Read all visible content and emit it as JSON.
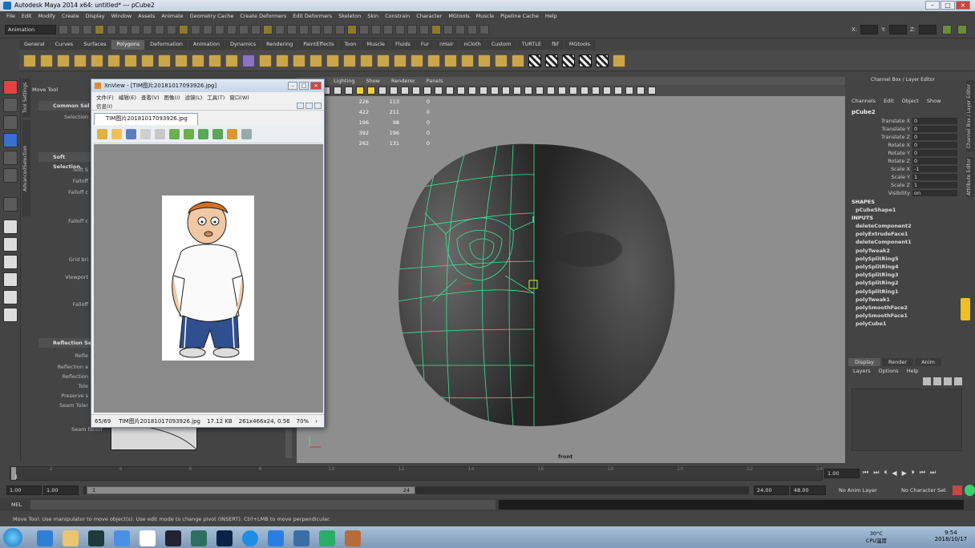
{
  "window": {
    "title": "Autodesk Maya 2014 x64: untitled*   ---   pCube2"
  },
  "menubar": [
    "File",
    "Edit",
    "Modify",
    "Create",
    "Display",
    "Window",
    "Assets",
    "Animate",
    "Geometry Cache",
    "Create Deformers",
    "Edit Deformers",
    "Skeleton",
    "Skin",
    "Constrain",
    "Character",
    "MGtools",
    "Muscle",
    "Pipeline Cache",
    "Help"
  ],
  "statusline": {
    "mode": "Animation",
    "fields": [
      "X:",
      "Y:",
      "Z:"
    ]
  },
  "shelf_tabs": [
    "General",
    "Curves",
    "Surfaces",
    "Polygons",
    "Deformation",
    "Animation",
    "Dynamics",
    "Rendering",
    "PaintEffects",
    "Toon",
    "Muscle",
    "Fluids",
    "Fur",
    "nHair",
    "nCloth",
    "Custom",
    "TURTLE",
    "fbf",
    "MGtools"
  ],
  "shelf_active": "Polygons",
  "tool_settings": {
    "vtabs": [
      "Tool Settings",
      "AdvancedSelection"
    ],
    "header": "Move Tool",
    "sections": [
      {
        "title": "Common Sel",
        "rows": [
          "Selection"
        ]
      },
      {
        "title": "Soft Selection",
        "rows": [
          "Soft S",
          "Falloff",
          "Falloff c",
          "Falloff c",
          "Grid bri",
          "Viewport",
          "Falloff"
        ]
      },
      {
        "title": "Reflection Se",
        "rows": [
          "Refle",
          "Reflection a",
          "Reflection",
          "Tole",
          "Preserve s",
          "Seam Toler",
          "Seam falloff"
        ]
      }
    ]
  },
  "viewport": {
    "menu": [
      "ading",
      "Lighting",
      "Show",
      "Renderer",
      "Panels"
    ],
    "stats": [
      [
        "226",
        "113",
        "0"
      ],
      [
        "422",
        "211",
        "0"
      ],
      [
        "196",
        "98",
        "0"
      ],
      [
        "392",
        "196",
        "0"
      ],
      [
        "262",
        "131",
        "0"
      ]
    ],
    "camera": "front"
  },
  "xnview": {
    "title": "XnView - [TIM图片20181017093926.jpg]",
    "menu": [
      "文件(F)",
      "编辑(E)",
      "查看(V)",
      "图像(I)",
      "滤镜(L)",
      "工具(T)",
      "窗口(W)"
    ],
    "submenu": "信息(I)",
    "tab": "TIM图片20181017093926.jpg",
    "status": {
      "index": "65/69",
      "filename": "TIM图片20181017093926.jpg",
      "size": "17.12 KB",
      "dims": "261x466x24, 0.56",
      "zoom": "70%"
    }
  },
  "channel_box": {
    "tabs_vert": [
      "Channel Box / Layer Editor",
      "Attribute Editor"
    ],
    "title": "Channel Box / Layer Editor",
    "menu": [
      "Channels",
      "Edit",
      "Object",
      "Show"
    ],
    "object": "pCube2",
    "attrs": [
      {
        "k": "Translate X",
        "v": "0"
      },
      {
        "k": "Translate Y",
        "v": "0"
      },
      {
        "k": "Translate Z",
        "v": "0"
      },
      {
        "k": "Rotate X",
        "v": "0"
      },
      {
        "k": "Rotate Y",
        "v": "0"
      },
      {
        "k": "Rotate Z",
        "v": "0"
      },
      {
        "k": "Scale X",
        "v": "-1"
      },
      {
        "k": "Scale Y",
        "v": "1"
      },
      {
        "k": "Scale Z",
        "v": "1"
      },
      {
        "k": "Visibility",
        "v": "on"
      }
    ],
    "shapes_label": "SHAPES",
    "shapes": [
      "pCubeShape1"
    ],
    "inputs_label": "INPUTS",
    "inputs": [
      "deleteComponent2",
      "polyExtrudeFace1",
      "deleteComponent1",
      "polyTweak2",
      "polySplitRing5",
      "polySplitRing4",
      "polySplitRing3",
      "polySplitRing2",
      "polySplitRing1",
      "polyTweak1",
      "polySmoothFace2",
      "polySmoothFace1",
      "polyCube1"
    ]
  },
  "layer_editor": {
    "tabs": [
      "Display",
      "Render",
      "Anim"
    ],
    "menu": [
      "Layers",
      "Options",
      "Help"
    ]
  },
  "timeline": {
    "ticks": [
      "1",
      "2",
      "4",
      "6",
      "8",
      "10",
      "12",
      "14",
      "16",
      "18",
      "20",
      "22",
      "24"
    ],
    "current": "1.00"
  },
  "range": {
    "start": "1.00",
    "inner_start": "1.00",
    "slider_start": "1",
    "slider_end": "24",
    "end": "24.00",
    "outer_end": "48.00",
    "anim_layer": "No Anim Layer",
    "character": "No Character Set"
  },
  "mel_label": "MEL",
  "help_text": "Move Tool: Use manipulator to move object(s). Use edit mode to change pivot (INSERT). Ctrl+LMB to move perpendicular.",
  "taskbar": {
    "temp": "30°C",
    "temp_label": "CPU温度",
    "time": "9:54",
    "date": "2018/10/17"
  }
}
